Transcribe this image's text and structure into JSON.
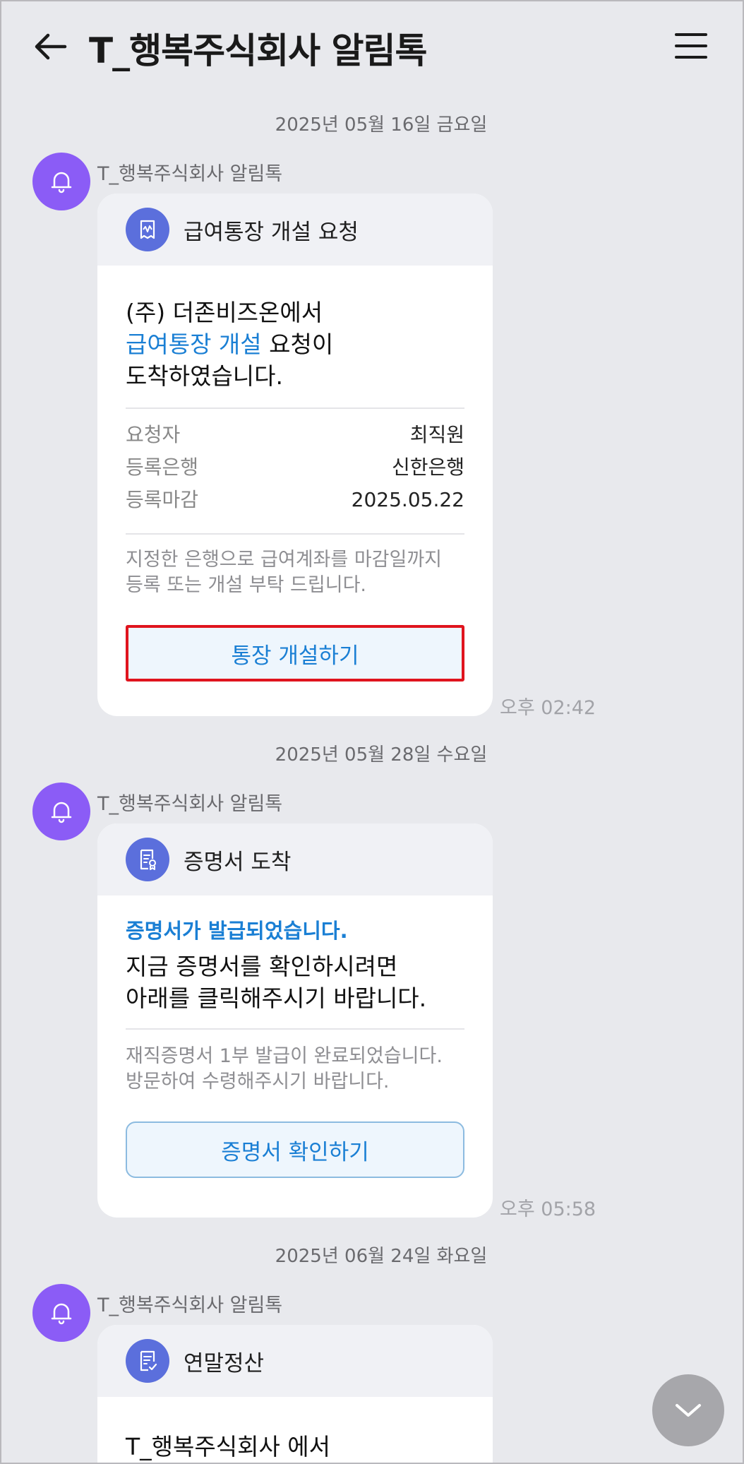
{
  "header": {
    "title": "T_행복주식회사 알림톡",
    "back_icon": "arrow-left-icon",
    "menu_icon": "hamburger-menu-icon"
  },
  "messages": [
    {
      "date": "2025년 05월 16일 금요일",
      "sender": "T_행복주식회사 알림톡",
      "card_title": "급여통장 개설 요청",
      "icon": "receipt-icon",
      "line1": "(주) 더존비즈온에서",
      "line2_highlight": "급여통장 개설",
      "line2_rest": " 요청이",
      "line3": "도착하였습니다.",
      "rows": [
        {
          "label": "요청자",
          "value": "최직원"
        },
        {
          "label": "등록은행",
          "value": "신한은행"
        },
        {
          "label": "등록마감",
          "value": "2025.05.22"
        }
      ],
      "note1": "지정한 은행으로 급여계좌를 마감일까지",
      "note2": "등록 또는 개설 부탁 드립니다.",
      "button": "통장 개설하기",
      "time": "오후 02:42"
    },
    {
      "date": "2025년 05월 28일 수요일",
      "sender": "T_행복주식회사 알림톡",
      "card_title": "증명서 도착",
      "icon": "certificate-icon",
      "headline": "증명서가 발급되었습니다.",
      "line1": "지금 증명서를 확인하시려면",
      "line2": "아래를 클릭해주시기 바랍니다.",
      "note1": "재직증명서 1부 발급이 완료되었습니다.",
      "note2": "방문하여 수령해주시기 바랍니다.",
      "button": "증명서 확인하기",
      "time": "오후 05:58"
    },
    {
      "date": "2025년 06월 24일 화요일",
      "sender": "T_행복주식회사 알림톡",
      "card_title": "연말정산",
      "icon": "document-check-icon",
      "line1": "T_행복주식회사 에서"
    }
  ],
  "fab_icon": "chevron-down-icon",
  "colors": {
    "avatar": "#8b5cf6",
    "card_icon": "#5b6fdc",
    "link_blue": "#1a7fd4",
    "highlight_red": "#e0141e"
  }
}
